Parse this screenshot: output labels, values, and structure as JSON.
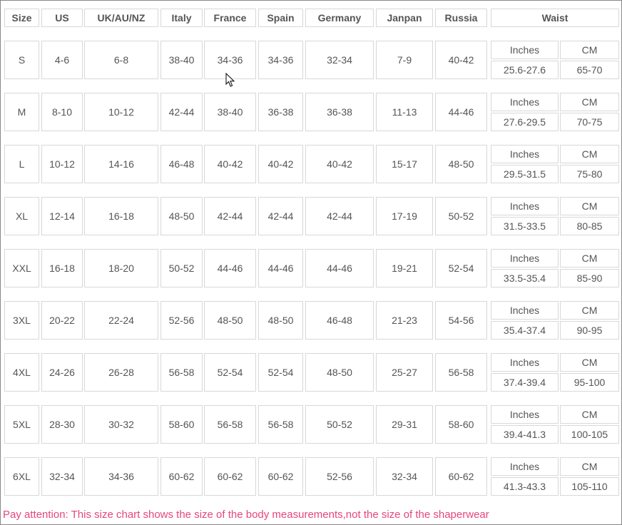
{
  "headers": [
    "Size",
    "US",
    "UK/AU/NZ",
    "Italy",
    "France",
    "Spain",
    "Germany",
    "Janpan",
    "Russia",
    "Waist"
  ],
  "waist_units": [
    "Inches",
    "CM"
  ],
  "rows": [
    {
      "size": "S",
      "us": "4-6",
      "uk": "6-8",
      "italy": "38-40",
      "france": "34-36",
      "spain": "34-36",
      "germany": "32-34",
      "japan": "7-9",
      "russia": "40-42",
      "inches": "25.6-27.6",
      "cm": "65-70"
    },
    {
      "size": "M",
      "us": "8-10",
      "uk": "10-12",
      "italy": "42-44",
      "france": "38-40",
      "spain": "36-38",
      "germany": "36-38",
      "japan": "11-13",
      "russia": "44-46",
      "inches": "27.6-29.5",
      "cm": "70-75"
    },
    {
      "size": "L",
      "us": "10-12",
      "uk": "14-16",
      "italy": "46-48",
      "france": "40-42",
      "spain": "40-42",
      "germany": "40-42",
      "japan": "15-17",
      "russia": "48-50",
      "inches": "29.5-31.5",
      "cm": "75-80"
    },
    {
      "size": "XL",
      "us": "12-14",
      "uk": "16-18",
      "italy": "48-50",
      "france": "42-44",
      "spain": "42-44",
      "germany": "42-44",
      "japan": "17-19",
      "russia": "50-52",
      "inches": "31.5-33.5",
      "cm": "80-85"
    },
    {
      "size": "XXL",
      "us": "16-18",
      "uk": "18-20",
      "italy": "50-52",
      "france": "44-46",
      "spain": "44-46",
      "germany": "44-46",
      "japan": "19-21",
      "russia": "52-54",
      "inches": "33.5-35.4",
      "cm": "85-90"
    },
    {
      "size": "3XL",
      "us": "20-22",
      "uk": "22-24",
      "italy": "52-56",
      "france": "48-50",
      "spain": "48-50",
      "germany": "46-48",
      "japan": "21-23",
      "russia": "54-56",
      "inches": "35.4-37.4",
      "cm": "90-95"
    },
    {
      "size": "4XL",
      "us": "24-26",
      "uk": "26-28",
      "italy": "56-58",
      "france": "52-54",
      "spain": "52-54",
      "germany": "48-50",
      "japan": "25-27",
      "russia": "56-58",
      "inches": "37.4-39.4",
      "cm": "95-100"
    },
    {
      "size": "5XL",
      "us": "28-30",
      "uk": "30-32",
      "italy": "58-60",
      "france": "56-58",
      "spain": "56-58",
      "germany": "50-52",
      "japan": "29-31",
      "russia": "58-60",
      "inches": "39.4-41.3",
      "cm": "100-105"
    },
    {
      "size": "6XL",
      "us": "32-34",
      "uk": "34-36",
      "italy": "60-62",
      "france": "60-62",
      "spain": "60-62",
      "germany": "52-56",
      "japan": "32-34",
      "russia": "60-62",
      "inches": "41.3-43.3",
      "cm": "105-110"
    }
  ],
  "note": "Pay attention: This size chart shows the size of the body measurements,not the size of the shaperwear",
  "colors": {
    "note": "#e8457a",
    "border": "#d8d8d8",
    "text": "#555555"
  },
  "cursor_icon": "mouse-pointer-icon"
}
